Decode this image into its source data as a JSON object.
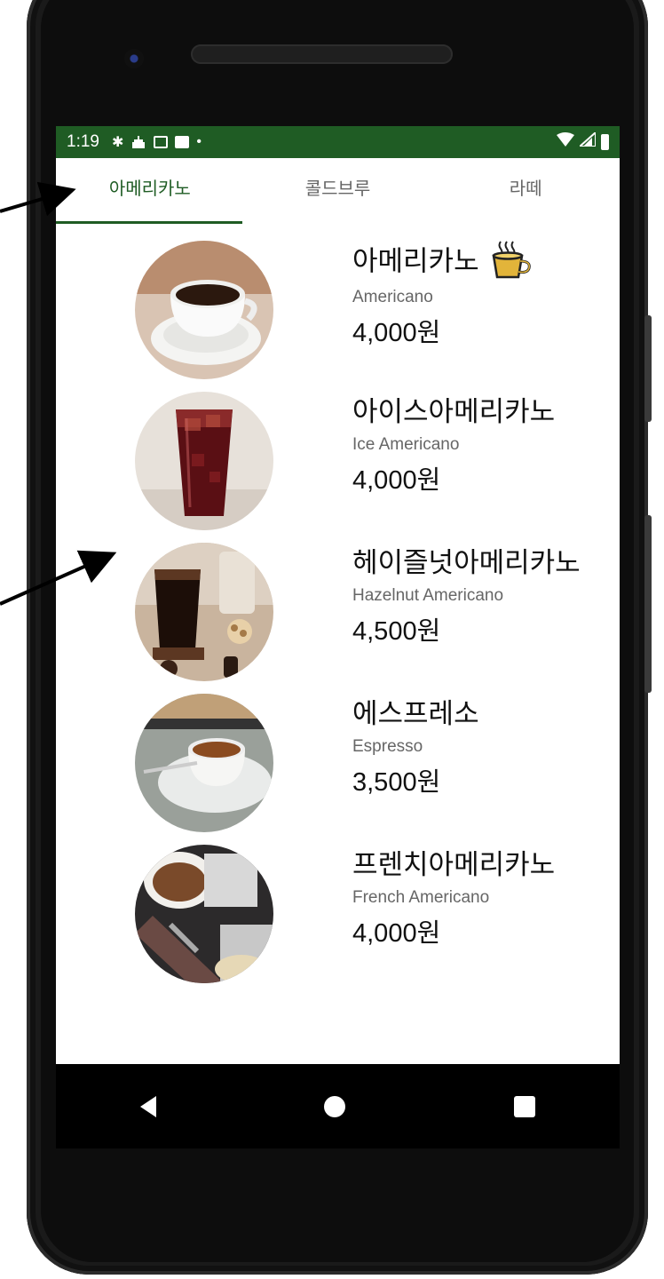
{
  "status_bar": {
    "time": "1:19",
    "icons": [
      "settings-icon",
      "cake-icon",
      "gmail-icon",
      "app-icon",
      "dot-icon"
    ],
    "right_icons": [
      "wifi-icon",
      "signal-icon",
      "battery-icon"
    ]
  },
  "tabs": [
    {
      "label": "아메리카노",
      "active": true
    },
    {
      "label": "콜드브루",
      "active": false
    },
    {
      "label": "라떼",
      "active": false
    }
  ],
  "menu": [
    {
      "name": "아메리카노",
      "english": "Americano",
      "price": "4,000원",
      "badge_icon": "hot-coffee-cup-icon"
    },
    {
      "name": "아이스아메리카노",
      "english": "Ice Americano",
      "price": "4,000원"
    },
    {
      "name": "헤이즐넛아메리카노",
      "english": "Hazelnut Americano",
      "price": "4,500원"
    },
    {
      "name": "에스프레소",
      "english": "Espresso",
      "price": "3,500원"
    },
    {
      "name": "프렌치아메리카노",
      "english": "French Americano",
      "price": "4,000원"
    }
  ],
  "nav_bar": [
    "back-icon",
    "home-icon",
    "recents-icon"
  ],
  "colors": {
    "accent": "#1f5c24",
    "frame": "#1a1a1a",
    "annotation_arrow": "#000000"
  }
}
